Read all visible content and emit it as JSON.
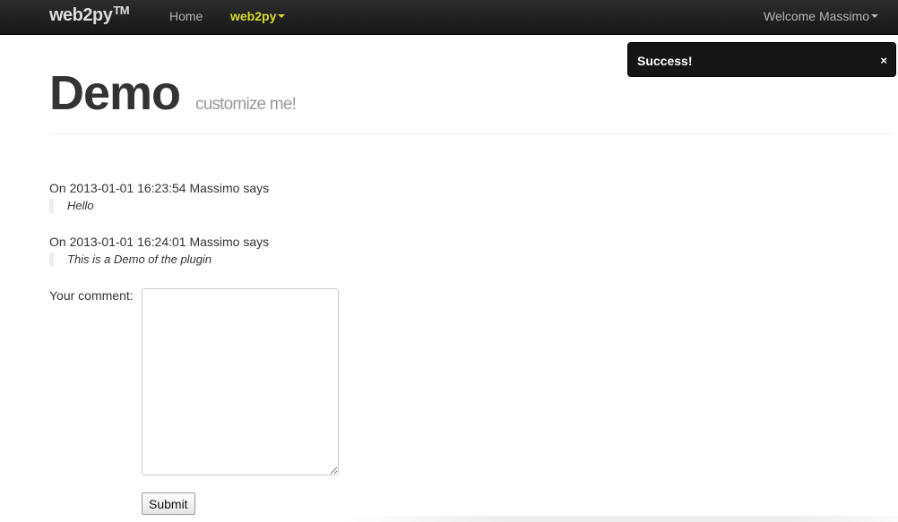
{
  "navbar": {
    "brand": "web2py",
    "brand_tm": "TM",
    "items": [
      {
        "label": "Home"
      },
      {
        "label": "web2py"
      }
    ],
    "user_menu": "Welcome Massimo",
    "colors": {
      "background": "#1b1b1b",
      "active": "#d6dc2a",
      "link": "#b4b4b4"
    }
  },
  "flash": {
    "message": "Success!",
    "close": "×"
  },
  "header": {
    "title": "Demo",
    "subtitle": "customize me!"
  },
  "comments": [
    {
      "meta": "On 2013-01-01 16:23:54 Massimo says",
      "body": "Hello"
    },
    {
      "meta": "On 2013-01-01 16:24:01 Massimo says",
      "body": "This is a Demo of the plugin"
    }
  ],
  "form": {
    "label": "Your comment:",
    "textarea_value": "",
    "submit_label": "Submit"
  }
}
